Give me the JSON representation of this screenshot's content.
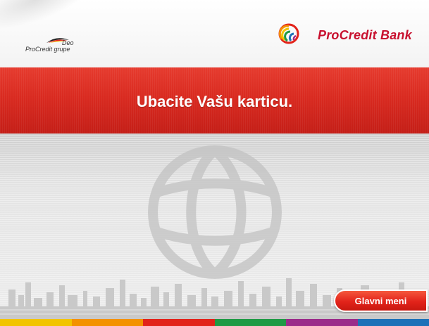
{
  "header": {
    "group_logo": {
      "line1": "Deo",
      "line2": "ProCredit grupe"
    },
    "bank_logo": {
      "name": "ProCredit Bank",
      "mark_icon": "procredit-circle-mark-icon"
    }
  },
  "banner": {
    "message": "Ubacite Vašu karticu."
  },
  "main": {
    "background_icon": "globe-icon"
  },
  "buttons": {
    "main_menu_label": "Glavni meni"
  },
  "colors": {
    "brand_red": "#d92a20",
    "logo_text_red": "#c8102e",
    "strip": [
      "#f2c400",
      "#f39200",
      "#e2231a",
      "#1f9a45",
      "#9b2b8a",
      "#1d71b8"
    ]
  }
}
